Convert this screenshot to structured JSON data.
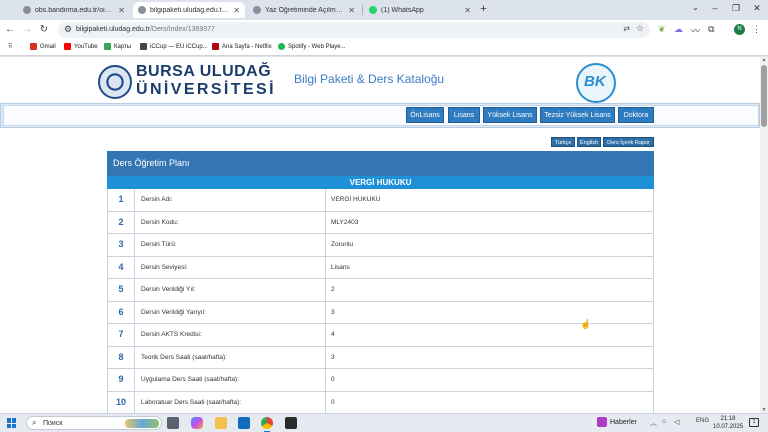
{
  "browser": {
    "tabs": [
      {
        "title": "obs.bandirma.edu.tr/oibs/bolo...",
        "favicon_color": "#8a8f99",
        "active": false
      },
      {
        "title": "bilgipaketi.uludag.edu.tr/Ders/...",
        "favicon_color": "#8a8f99",
        "active": true
      },
      {
        "title": "Yaz Öğretiminde Açılması Planla...",
        "favicon_color": "#8a8f99",
        "active": false
      },
      {
        "title": "(1) WhatsApp",
        "favicon_color": "#25d366",
        "active": false
      }
    ],
    "url_host": "bilgipaketi.uludag.edu.tr",
    "url_path": "/Ders/Index/1369377",
    "bookmarks": [
      {
        "label": "Gmail",
        "icon_color": "#d93025"
      },
      {
        "label": "YouTube",
        "icon_color": "#ff0000"
      },
      {
        "label": "Карты",
        "icon_color": "#34a853"
      },
      {
        "label": "iCCup — EU iCCup...",
        "icon_color": "#444444"
      },
      {
        "label": "Ana Sayfa - Netflix",
        "icon_color": "#b20710"
      },
      {
        "label": "Spotify - Web Playe...",
        "icon_color": "#1db954"
      }
    ],
    "profile_initial": "N"
  },
  "site": {
    "university_line1": "BURSA ULUDAĞ",
    "university_line2": "ÜNİVERSİTESİ",
    "title": "Bilgi Paketi & Ders Kataloğu",
    "bk_logo_text": "BK",
    "menu": [
      "ÖnLisans",
      "Lisans",
      "Yüksek Lisans",
      "Tezsiz Yüksek Lisans",
      "Doktora"
    ],
    "lang_buttons": [
      "Türkçe",
      "English",
      "Ders İçerik Rapor"
    ]
  },
  "plan": {
    "heading": "Ders Öğretim Planı",
    "course_name": "VERGİ HUKUKU",
    "rows": [
      {
        "num": "1",
        "label": "Dersin Adı:",
        "value": "VERGİ HUKUKU"
      },
      {
        "num": "2",
        "label": "Dersin Kodu:",
        "value": "MLY2403"
      },
      {
        "num": "3",
        "label": "Dersin Türü:",
        "value": "Zorunlu"
      },
      {
        "num": "4",
        "label": "Dersin Seviyesi:",
        "value": "Lisans"
      },
      {
        "num": "5",
        "label": "Dersin Verildiği Yıl:",
        "value": "2"
      },
      {
        "num": "6",
        "label": "Dersin Verildiği Yarıyıl:",
        "value": "3"
      },
      {
        "num": "7",
        "label": "Dersin AKTS Kredisi:",
        "value": "4"
      },
      {
        "num": "8",
        "label": "Teorik Ders Saati (saat/hafta):",
        "value": "3"
      },
      {
        "num": "9",
        "label": "Uygulama Ders Saati (saat/hafta):",
        "value": "0"
      },
      {
        "num": "10",
        "label": "Laboratuar Ders Saati (saat/hafta):",
        "value": "0"
      }
    ]
  },
  "taskbar": {
    "search_placeholder": "Поиск",
    "weather_label": "Haberler",
    "lang": "ENG",
    "time": "21:18",
    "date": "10.07.2025",
    "notifications": "1"
  }
}
